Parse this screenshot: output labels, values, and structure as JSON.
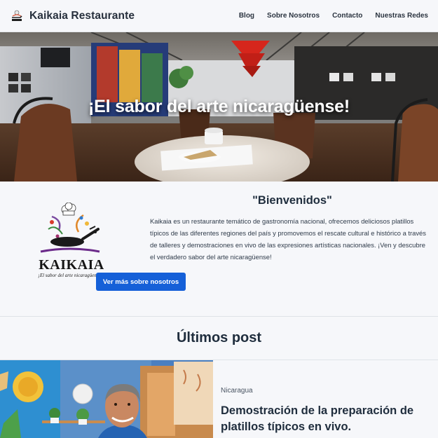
{
  "nav": {
    "brand": "Kaikaia Restaurante",
    "links": [
      {
        "label": "Blog"
      },
      {
        "label": "Sobre Nosotros"
      },
      {
        "label": "Contacto"
      },
      {
        "label": "Nuestras Redes"
      }
    ]
  },
  "hero": {
    "title": "¡El sabor del arte nicaragüense!"
  },
  "welcome": {
    "title": "\"Bienvenidos\"",
    "text": "Kaikaia es un restaurante temático de gastronomía nacional, ofrecemos deliciosos platillos típicos de las diferentes regiones del país y promovemos el rescate cultural e histórico a través de talleres y demostraciones en vivo de las expresiones artísticas nacionales. ¡Ven y descubre el verdadero sabor del arte nicaragüense!",
    "button_label": "Ver más sobre nosotros",
    "logo_word": "KAIKAIA",
    "logo_tagline": "¡El sabor del arte nicaragüense!"
  },
  "posts": {
    "title": "Últimos post",
    "items": [
      {
        "category": "Nicaragua",
        "title": "Demostración de la preparación de platillos típicos en vivo."
      }
    ]
  },
  "colors": {
    "primary": "#1560d8",
    "text_dark": "#1f2d3d",
    "background": "#f6f7fa"
  }
}
